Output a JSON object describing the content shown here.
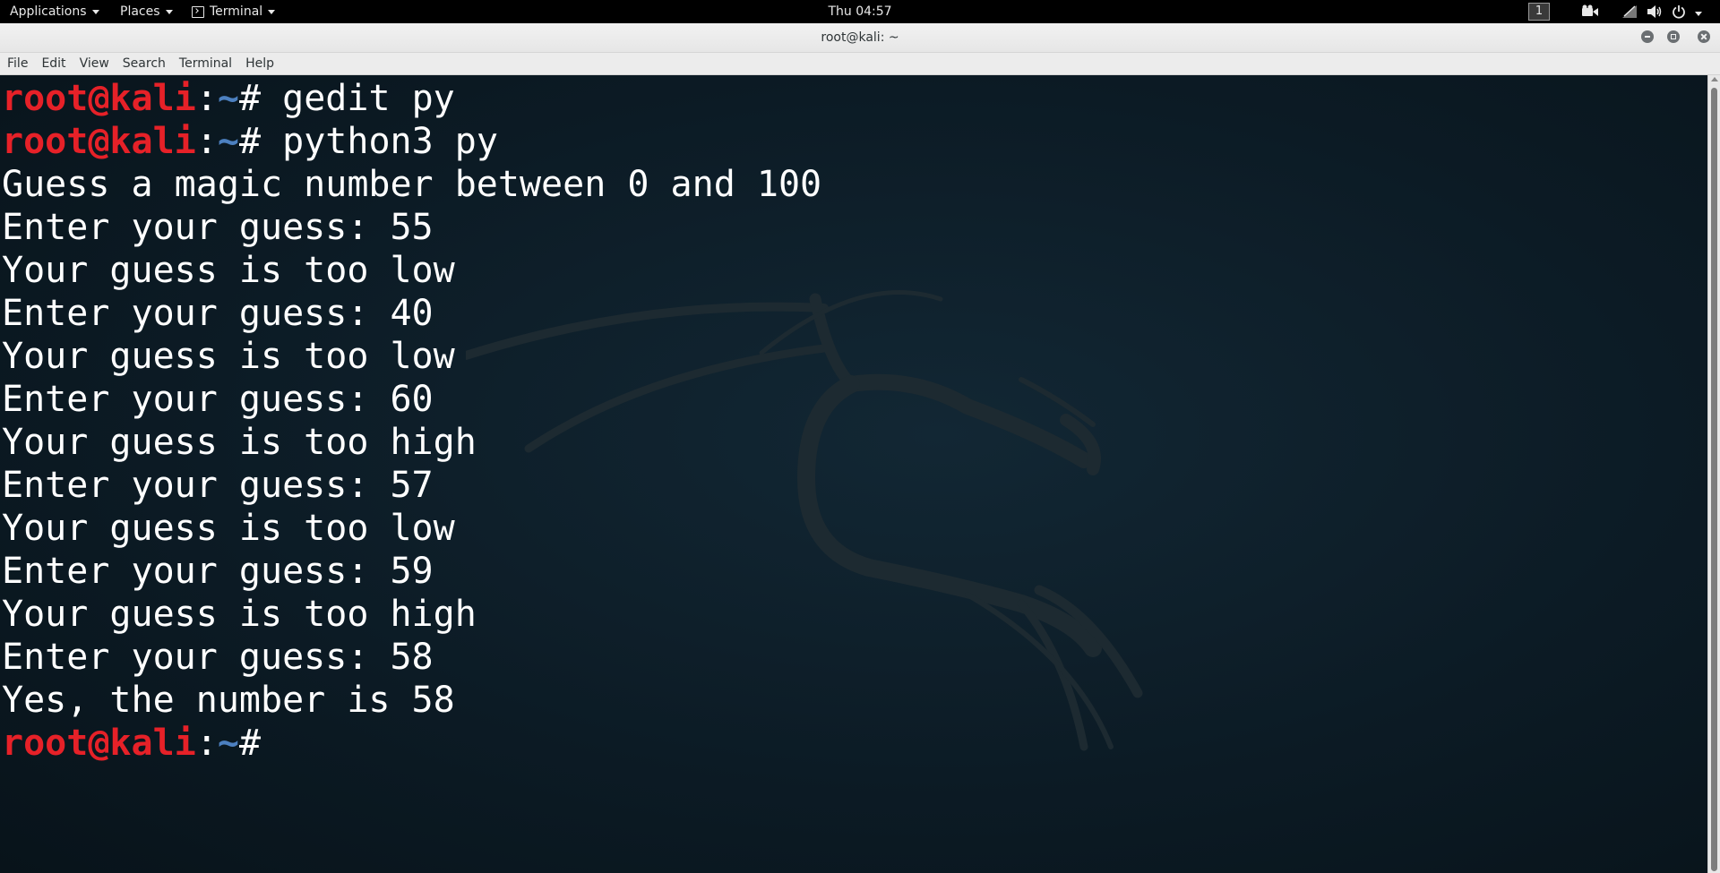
{
  "panel": {
    "applications_label": "Applications",
    "places_label": "Places",
    "terminal_label": "Terminal",
    "clock": "Thu 04:57",
    "workspace_number": "1",
    "tray_icons": [
      "video-camera-icon",
      "network-disabled-icon",
      "volume-icon",
      "power-icon"
    ]
  },
  "window": {
    "title": "root@kali: ~",
    "buttons": [
      "minimize",
      "maximize",
      "close"
    ]
  },
  "menubar": {
    "items": [
      "File",
      "Edit",
      "View",
      "Search",
      "Terminal",
      "Help"
    ]
  },
  "terminal": {
    "prompt": {
      "user_host": "root@kali",
      "colon": ":",
      "path": "~",
      "symbol": "# "
    },
    "lines": [
      {
        "type": "prompt",
        "command": "gedit py"
      },
      {
        "type": "prompt",
        "command": "python3 py"
      },
      {
        "type": "output",
        "text": "Guess a magic number between 0 and 100"
      },
      {
        "type": "output",
        "text": "Enter your guess: 55"
      },
      {
        "type": "output",
        "text": "Your guess is too low"
      },
      {
        "type": "output",
        "text": "Enter your guess: 40"
      },
      {
        "type": "output",
        "text": "Your guess is too low"
      },
      {
        "type": "output",
        "text": "Enter your guess: 60"
      },
      {
        "type": "output",
        "text": "Your guess is too high"
      },
      {
        "type": "output",
        "text": "Enter your guess: 57"
      },
      {
        "type": "output",
        "text": "Your guess is too low"
      },
      {
        "type": "output",
        "text": "Enter your guess: 59"
      },
      {
        "type": "output",
        "text": "Your guess is too high"
      },
      {
        "type": "output",
        "text": "Enter your guess: 58"
      },
      {
        "type": "output",
        "text": "Yes, the number is 58"
      },
      {
        "type": "prompt",
        "command": ""
      }
    ]
  },
  "colors": {
    "prompt_user": "#e62128",
    "prompt_path": "#4c80c0",
    "terminal_text": "#ffffff",
    "terminal_bg": "#0c1b25"
  }
}
